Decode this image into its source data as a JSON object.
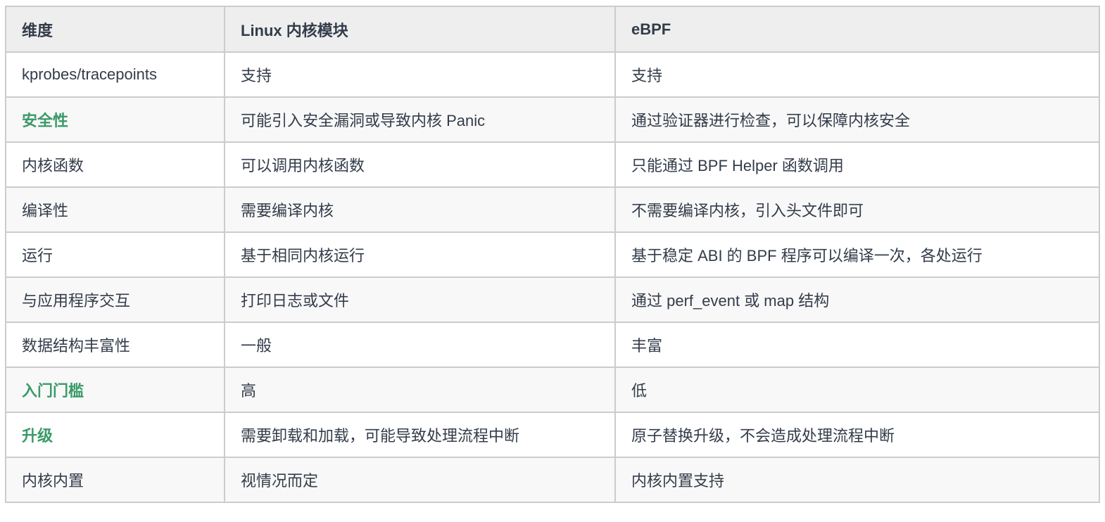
{
  "headers": [
    "维度",
    "Linux 内核模块",
    "eBPF"
  ],
  "rows": [
    {
      "dim": "kprobes/tracepoints",
      "linux": "支持",
      "ebpf": "支持",
      "highlight": false
    },
    {
      "dim": "安全性",
      "linux": "可能引入安全漏洞或导致内核 Panic",
      "ebpf": "通过验证器进行检查，可以保障内核安全",
      "highlight": true
    },
    {
      "dim": "内核函数",
      "linux": "可以调用内核函数",
      "ebpf": "只能通过 BPF Helper 函数调用",
      "highlight": false
    },
    {
      "dim": "编译性",
      "linux": "需要编译内核",
      "ebpf": "不需要编译内核，引入头文件即可",
      "highlight": false
    },
    {
      "dim": "运行",
      "linux": "基于相同内核运行",
      "ebpf": "基于稳定 ABI 的 BPF 程序可以编译一次，各处运行",
      "highlight": false
    },
    {
      "dim": "与应用程序交互",
      "linux": "打印日志或文件",
      "ebpf": "通过 perf_event 或 map 结构",
      "highlight": false
    },
    {
      "dim": "数据结构丰富性",
      "linux": "一般",
      "ebpf": "丰富",
      "highlight": false
    },
    {
      "dim": "入门门槛",
      "linux": "高",
      "ebpf": "低",
      "highlight": true
    },
    {
      "dim": "升级",
      "linux": "需要卸载和加载，可能导致处理流程中断",
      "ebpf": "原子替换升级，不会造成处理流程中断",
      "highlight": true
    },
    {
      "dim": "内核内置",
      "linux": "视情况而定",
      "ebpf": "内核内置支持",
      "highlight": false
    }
  ],
  "colors": {
    "highlight": "#3a9a68",
    "text": "#333c4a",
    "header_bg": "#eeeeee",
    "border": "#cccccc"
  }
}
